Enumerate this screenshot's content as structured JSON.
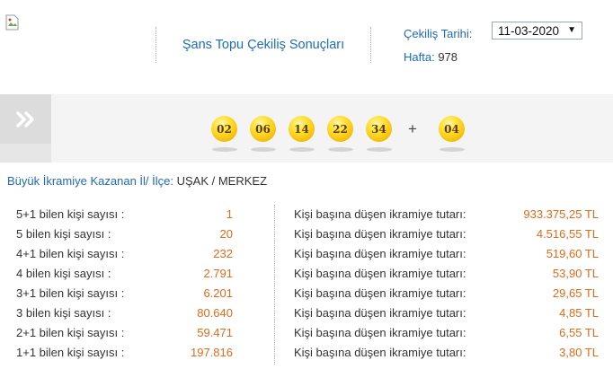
{
  "header": {
    "title": "Şans Topu Çekiliş Sonuçları",
    "draw_date_label": "Çekiliş Tarihi:",
    "draw_date_value": "11-03-2020",
    "week_label": "Hafta:",
    "week_value": "978"
  },
  "balls": {
    "main": [
      "02",
      "06",
      "14",
      "22",
      "34"
    ],
    "plus_sign": "+",
    "bonus": "04"
  },
  "winner": {
    "label": "Büyük İkramiye Kazanan İl/ İlçe:",
    "value": "UŞAK / MERKEZ"
  },
  "results": [
    {
      "category": "5+1 bilen kişi sayısı :",
      "count": "1",
      "prize_label": "Kişi başına düşen ikramiye tutarı:",
      "prize": "933.375,25 TL"
    },
    {
      "category": "5 bilen kişi sayısı :",
      "count": "20",
      "prize_label": "Kişi başına düşen ikramiye tutarı:",
      "prize": "4.516,55 TL"
    },
    {
      "category": "4+1 bilen kişi sayısı :",
      "count": "232",
      "prize_label": "Kişi başına düşen ikramiye tutarı:",
      "prize": "519,60 TL"
    },
    {
      "category": "4 bilen kişi sayısı :",
      "count": "2.791",
      "prize_label": "Kişi başına düşen ikramiye tutarı:",
      "prize": "53,90 TL"
    },
    {
      "category": "3+1 bilen kişi sayısı :",
      "count": "6.201",
      "prize_label": "Kişi başına düşen ikramiye tutarı:",
      "prize": "29,65 TL"
    },
    {
      "category": "3 bilen kişi sayısı :",
      "count": "80.640",
      "prize_label": "Kişi başına düşen ikramiye tutarı:",
      "prize": "4,85 TL"
    },
    {
      "category": "2+1 bilen kişi sayısı :",
      "count": "59.471",
      "prize_label": "Kişi başına düşen ikramiye tutarı:",
      "prize": "6,55 TL"
    },
    {
      "category": "1+1 bilen kişi sayısı :",
      "count": "197.816",
      "prize_label": "Kişi başına düşen ikramiye tutarı:",
      "prize": "3,80 TL"
    }
  ],
  "colors": {
    "link_blue": "#1e6bb8",
    "value_orange": "#e06a1b",
    "ball_yellow": "#ffe032"
  },
  "icons": {
    "broken_image": "broken-image-icon",
    "next_arrow": "double-chevron-right-icon",
    "dropdown": "caret-down-icon"
  }
}
